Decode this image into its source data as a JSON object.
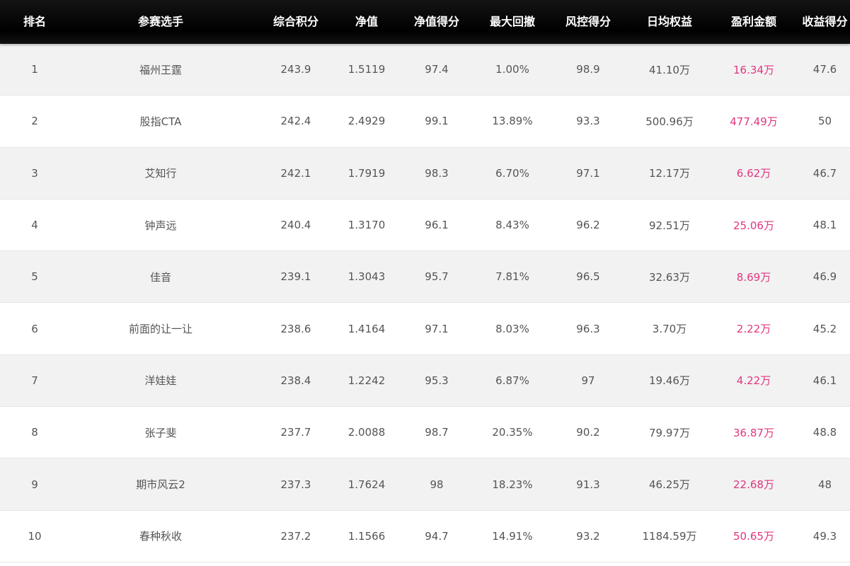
{
  "columns": [
    "排名",
    "参赛选手",
    "综合积分",
    "净值",
    "净值得分",
    "最大回撤",
    "风控得分",
    "日均权益",
    "盈利金额",
    "收益得分"
  ],
  "rows": [
    {
      "rank": "1",
      "name": "福州王霆",
      "score": "243.9",
      "nav": "1.5119",
      "nav_score": "97.4",
      "max_drawdown": "1.00%",
      "risk_score": "98.9",
      "avg_equity": "41.10万",
      "profit": "16.34万",
      "return_score": "47.6"
    },
    {
      "rank": "2",
      "name": "股指CTA",
      "score": "242.4",
      "nav": "2.4929",
      "nav_score": "99.1",
      "max_drawdown": "13.89%",
      "risk_score": "93.3",
      "avg_equity": "500.96万",
      "profit": "477.49万",
      "return_score": "50"
    },
    {
      "rank": "3",
      "name": "艾知行",
      "score": "242.1",
      "nav": "1.7919",
      "nav_score": "98.3",
      "max_drawdown": "6.70%",
      "risk_score": "97.1",
      "avg_equity": "12.17万",
      "profit": "6.62万",
      "return_score": "46.7"
    },
    {
      "rank": "4",
      "name": "钟声远",
      "score": "240.4",
      "nav": "1.3170",
      "nav_score": "96.1",
      "max_drawdown": "8.43%",
      "risk_score": "96.2",
      "avg_equity": "92.51万",
      "profit": "25.06万",
      "return_score": "48.1"
    },
    {
      "rank": "5",
      "name": "佳音",
      "score": "239.1",
      "nav": "1.3043",
      "nav_score": "95.7",
      "max_drawdown": "7.81%",
      "risk_score": "96.5",
      "avg_equity": "32.63万",
      "profit": "8.69万",
      "return_score": "46.9"
    },
    {
      "rank": "6",
      "name": "前面的让一让",
      "score": "238.6",
      "nav": "1.4164",
      "nav_score": "97.1",
      "max_drawdown": "8.03%",
      "risk_score": "96.3",
      "avg_equity": "3.70万",
      "profit": "2.22万",
      "return_score": "45.2"
    },
    {
      "rank": "7",
      "name": "洋娃娃",
      "score": "238.4",
      "nav": "1.2242",
      "nav_score": "95.3",
      "max_drawdown": "6.87%",
      "risk_score": "97",
      "avg_equity": "19.46万",
      "profit": "4.22万",
      "return_score": "46.1"
    },
    {
      "rank": "8",
      "name": "张子斐",
      "score": "237.7",
      "nav": "2.0088",
      "nav_score": "98.7",
      "max_drawdown": "20.35%",
      "risk_score": "90.2",
      "avg_equity": "79.97万",
      "profit": "36.87万",
      "return_score": "48.8"
    },
    {
      "rank": "9",
      "name": "期市风云2",
      "score": "237.3",
      "nav": "1.7624",
      "nav_score": "98",
      "max_drawdown": "18.23%",
      "risk_score": "91.3",
      "avg_equity": "46.25万",
      "profit": "22.68万",
      "return_score": "48"
    },
    {
      "rank": "10",
      "name": "春种秋收",
      "score": "237.2",
      "nav": "1.1566",
      "nav_score": "94.7",
      "max_drawdown": "14.91%",
      "risk_score": "93.2",
      "avg_equity": "1184.59万",
      "profit": "50.65万",
      "return_score": "49.3"
    }
  ],
  "colors": {
    "header_bg": "#000000",
    "header_text": "#ffffff",
    "row_alt_bg": "#f2f2f2",
    "cell_text": "#555555",
    "profit_text": "#e0367f"
  }
}
